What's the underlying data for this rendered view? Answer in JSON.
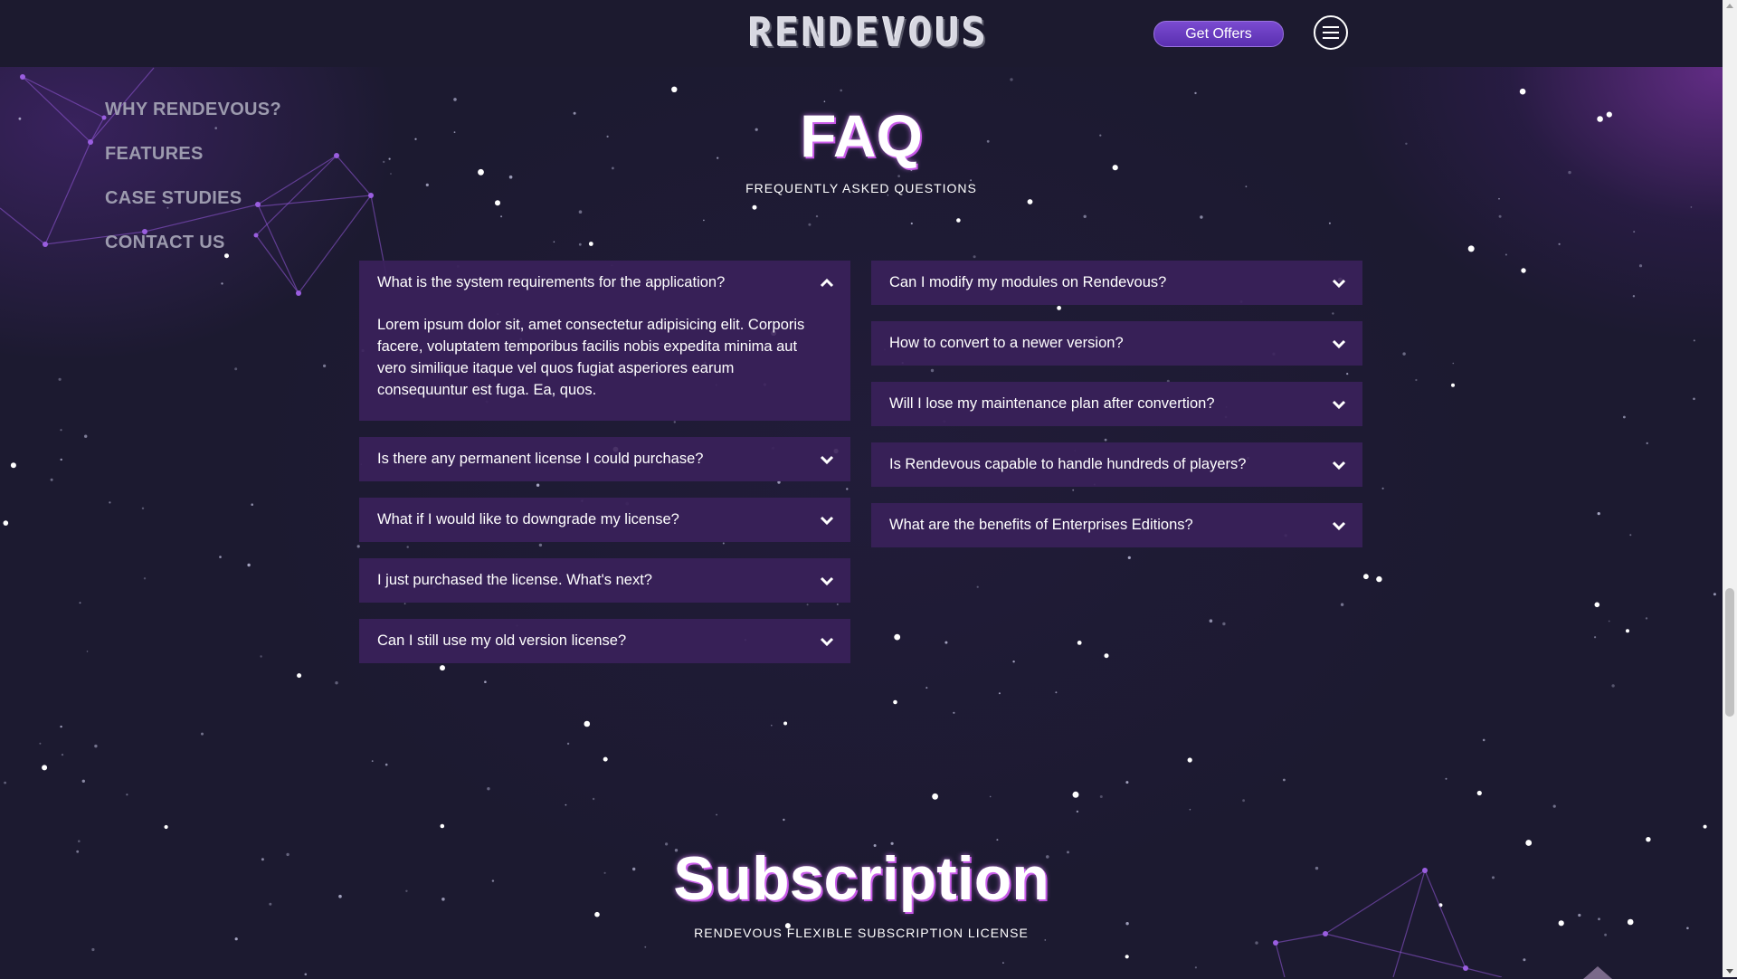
{
  "header": {
    "logo_text": "RENDEVOUS",
    "offers_button": "Get Offers"
  },
  "sidenav": {
    "items": [
      {
        "label": "WHY RENDEVOUS?"
      },
      {
        "label": "FEATURES"
      },
      {
        "label": "CASE STUDIES"
      },
      {
        "label": "CONTACT US"
      }
    ]
  },
  "faq": {
    "title": "FAQ",
    "subtitle": "FREQUENTLY ASKED QUESTIONS",
    "left": [
      {
        "question": "What is the system requirements for the application?",
        "expanded": true,
        "answer": "Lorem ipsum dolor sit, amet consectetur adipisicing elit. Corporis facere, voluptatem temporibus facilis nobis expedita minima aut vero similique itaque vel quos fugiat asperiores earum consequuntur est fuga. Ea, quos."
      },
      {
        "question": "Is there any permanent license I could purchase?",
        "expanded": false
      },
      {
        "question": "What if I would like to downgrade my license?",
        "expanded": false
      },
      {
        "question": "I just purchased the license. What's next?",
        "expanded": false
      },
      {
        "question": "Can I still use my old version license?",
        "expanded": false
      }
    ],
    "right": [
      {
        "question": "Can I modify my modules on Rendevous?",
        "expanded": false
      },
      {
        "question": "How to convert to a newer version?",
        "expanded": false
      },
      {
        "question": "Will I lose my maintenance plan after convertion?",
        "expanded": false
      },
      {
        "question": "Is Rendevous capable to handle hundreds of players?",
        "expanded": false
      },
      {
        "question": "What are the benefits of Enterprises Editions?",
        "expanded": false
      }
    ]
  },
  "subscription": {
    "title": "Subscription",
    "subtitle": "RENDEVOUS FLEXIBLE SUBSCRIPTION LICENSE"
  },
  "colors": {
    "background": "#1c1a30",
    "accordion": "#3a215a",
    "accent": "#6a3cc4",
    "glow": "#c24fe0"
  }
}
